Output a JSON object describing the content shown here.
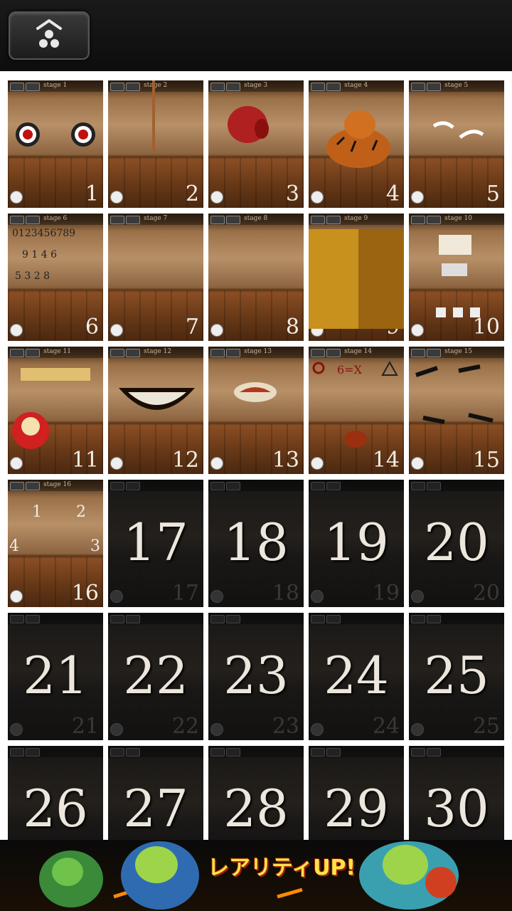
{
  "header": {
    "home_icon": "home-crest-icon"
  },
  "stages": [
    {
      "label": "stage 1",
      "num": "1",
      "locked": false
    },
    {
      "label": "stage 2",
      "num": "2",
      "locked": false
    },
    {
      "label": "stage 3",
      "num": "3",
      "locked": false
    },
    {
      "label": "stage 4",
      "num": "4",
      "locked": false
    },
    {
      "label": "stage 5",
      "num": "5",
      "locked": false
    },
    {
      "label": "stage 6",
      "num": "6",
      "locked": false
    },
    {
      "label": "stage 7",
      "num": "7",
      "locked": false
    },
    {
      "label": "stage 8",
      "num": "8",
      "locked": false
    },
    {
      "label": "stage 9",
      "num": "9",
      "locked": false
    },
    {
      "label": "stage 10",
      "num": "10",
      "locked": false
    },
    {
      "label": "stage 11",
      "num": "11",
      "locked": false
    },
    {
      "label": "stage 12",
      "num": "12",
      "locked": false
    },
    {
      "label": "stage 13",
      "num": "13",
      "locked": false
    },
    {
      "label": "stage 14",
      "num": "14",
      "locked": false
    },
    {
      "label": "stage 15",
      "num": "15",
      "locked": false
    },
    {
      "label": "stage 16",
      "num": "16",
      "locked": false
    },
    {
      "label": "",
      "num": "17",
      "locked": true
    },
    {
      "label": "",
      "num": "18",
      "locked": true
    },
    {
      "label": "",
      "num": "19",
      "locked": true
    },
    {
      "label": "",
      "num": "20",
      "locked": true
    },
    {
      "label": "",
      "num": "21",
      "locked": true
    },
    {
      "label": "",
      "num": "22",
      "locked": true
    },
    {
      "label": "",
      "num": "23",
      "locked": true
    },
    {
      "label": "",
      "num": "24",
      "locked": true
    },
    {
      "label": "",
      "num": "25",
      "locked": true
    },
    {
      "label": "",
      "num": "26",
      "locked": true
    },
    {
      "label": "",
      "num": "27",
      "locked": true
    },
    {
      "label": "",
      "num": "28",
      "locked": true
    },
    {
      "label": "",
      "num": "29",
      "locked": true
    },
    {
      "label": "",
      "num": "30",
      "locked": true
    }
  ],
  "ad": {
    "text": "レアリティUP!"
  }
}
